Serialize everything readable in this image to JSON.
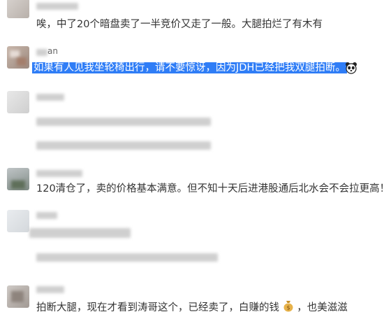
{
  "comments": [
    {
      "text": "唉，中了20个暗盘卖了一半竞价又走了一般。大腿拍烂了有木有"
    },
    {
      "username_partial": "an",
      "text": "如果有人见我坐轮椅出行，请不要惊讶，因为JDH已经把我双腿拍断。",
      "highlighted": true,
      "emoji": "panda-face-icon"
    },
    {
      "text": ""
    },
    {
      "text": "120清仓了，卖的价格基本满意。但不知十天后进港股通后北水会不会拉更高！"
    },
    {
      "text": ""
    },
    {
      "text_before": "拍断大腿，现在才看到涛哥这个，已经卖了，白赚的钱",
      "emoji": "money-bag-icon",
      "text_after": "，也美滋滋"
    }
  ],
  "colors": {
    "highlight": "#2f7df6",
    "text": "#333333",
    "blur": "#cfcfcf"
  }
}
